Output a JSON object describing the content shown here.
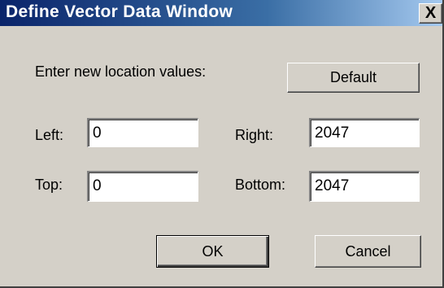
{
  "window": {
    "title": "Define Vector Data Window",
    "close_symbol": "X"
  },
  "prompt": "Enter new location values:",
  "buttons": {
    "default_label": "Default",
    "ok_label": "OK",
    "cancel_label": "Cancel"
  },
  "fields": {
    "left": {
      "label": "Left:",
      "value": "0"
    },
    "right": {
      "label": "Right:",
      "value": "2047"
    },
    "top": {
      "label": "Top:",
      "value": "0"
    },
    "bottom": {
      "label": "Bottom:",
      "value": "2047"
    }
  },
  "colors": {
    "titlebar_start": "#0a246a",
    "titlebar_end": "#a6caf0",
    "dialog_bg": "#d4d0c8"
  }
}
